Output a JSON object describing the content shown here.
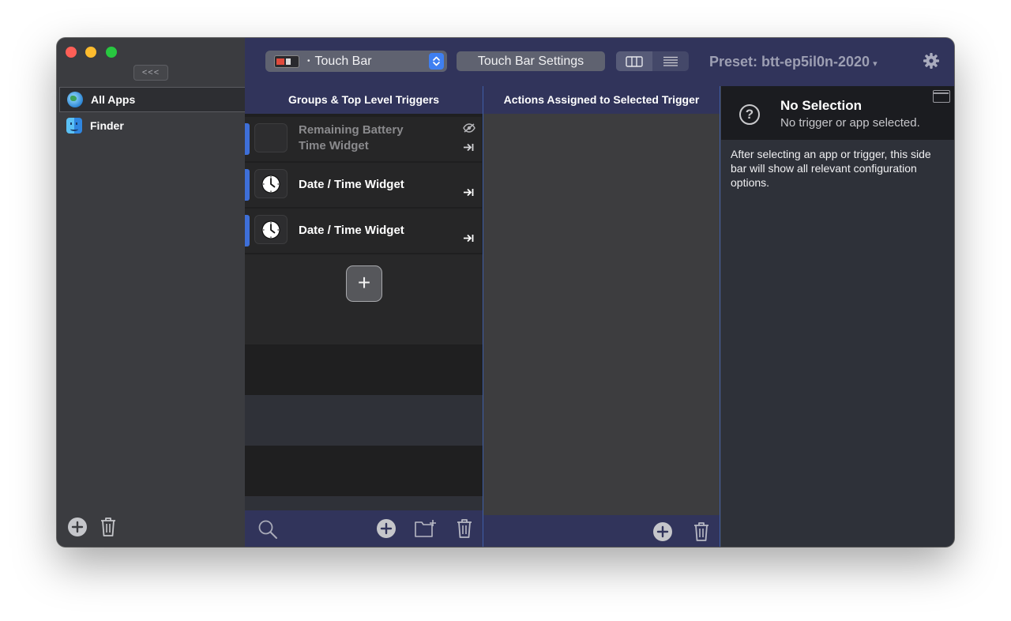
{
  "sidebar": {
    "collapse_label": "<<<",
    "apps": [
      {
        "label": "All Apps",
        "icon": "globe-icon",
        "selected": true
      },
      {
        "label": "Finder",
        "icon": "finder-icon",
        "selected": false
      }
    ]
  },
  "toolbar": {
    "device_select_label": "Touch Bar",
    "device_select_dot": "•",
    "settings_label": "Touch Bar Settings",
    "preset_label": "Preset: btt-ep5il0n-2020",
    "preset_caret": "▾"
  },
  "triggers": {
    "header": "Groups & Top Level Triggers",
    "items": [
      {
        "line1": "Remaining Battery",
        "line2": "Time Widget",
        "disabled": true
      },
      {
        "line1": "Date / Time Widget",
        "disabled": false
      },
      {
        "line1": "Date / Time Widget",
        "disabled": false
      }
    ],
    "add_label": "+"
  },
  "actions": {
    "header": "Actions Assigned to Selected Trigger"
  },
  "panel": {
    "help_glyph": "?",
    "title": "No Selection",
    "subtitle": "No trigger or app selected.",
    "description": "After selecting an app or trigger, this side bar will show all relevant configuration options."
  },
  "colors": {
    "toolbar_bg": "#31345b",
    "accent_blue": "#3e6fd8",
    "close": "#fe5f57",
    "minimize": "#febc2e",
    "maximize": "#28c840"
  }
}
